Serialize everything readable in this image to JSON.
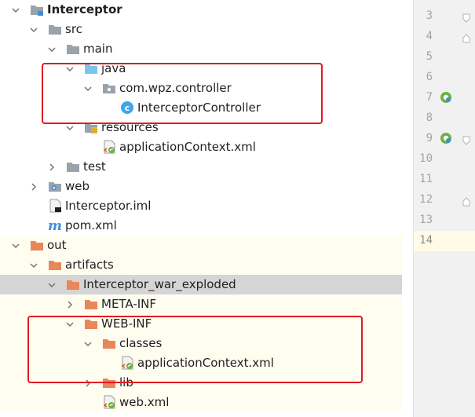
{
  "tree": {
    "items": [
      {
        "label": "Interceptor",
        "icon": "module-folder-icon",
        "expanded": true
      },
      {
        "label": "src",
        "icon": "folder-icon",
        "expanded": true
      },
      {
        "label": "main",
        "icon": "folder-icon",
        "expanded": true
      },
      {
        "label": "java",
        "icon": "source-root-folder-icon",
        "expanded": true
      },
      {
        "label": "com.wpz.controller",
        "icon": "package-icon",
        "expanded": true
      },
      {
        "label": "InterceptorController",
        "icon": "java-class-icon"
      },
      {
        "label": "resources",
        "icon": "resources-folder-icon",
        "expanded": true
      },
      {
        "label": "applicationContext.xml",
        "icon": "spring-xml-icon"
      },
      {
        "label": "test",
        "icon": "folder-icon",
        "expanded": false
      },
      {
        "label": "web",
        "icon": "web-folder-icon",
        "expanded": false
      },
      {
        "label": "Interceptor.iml",
        "icon": "iml-file-icon"
      },
      {
        "label": "pom.xml",
        "icon": "maven-icon"
      },
      {
        "label": "out",
        "icon": "orange-folder-icon",
        "expanded": true
      },
      {
        "label": "artifacts",
        "icon": "orange-folder-icon",
        "expanded": true
      },
      {
        "label": "Interceptor_war_exploded",
        "icon": "orange-folder-icon",
        "expanded": true,
        "selected": true
      },
      {
        "label": "META-INF",
        "icon": "orange-folder-icon",
        "expanded": false
      },
      {
        "label": "WEB-INF",
        "icon": "orange-folder-icon",
        "expanded": true
      },
      {
        "label": "classes",
        "icon": "orange-folder-icon",
        "expanded": true
      },
      {
        "label": "applicationContext.xml",
        "icon": "spring-xml-icon"
      },
      {
        "label": "lib",
        "icon": "orange-folder-icon",
        "expanded": false
      },
      {
        "label": "web.xml",
        "icon": "spring-xml-icon"
      }
    ]
  },
  "editor": {
    "line_numbers": [
      "3",
      "4",
      "5",
      "6",
      "7",
      "8",
      "9",
      "10",
      "11",
      "12",
      "13",
      "14"
    ],
    "current_line": "14"
  },
  "colors": {
    "highlight": "#e01b24",
    "selection": "#d5d5d5",
    "out_background": "#fffdf0",
    "folder_orange": "#e8875a",
    "folder_blue": "#79c6ea",
    "folder_gray": "#9aa3ac"
  }
}
